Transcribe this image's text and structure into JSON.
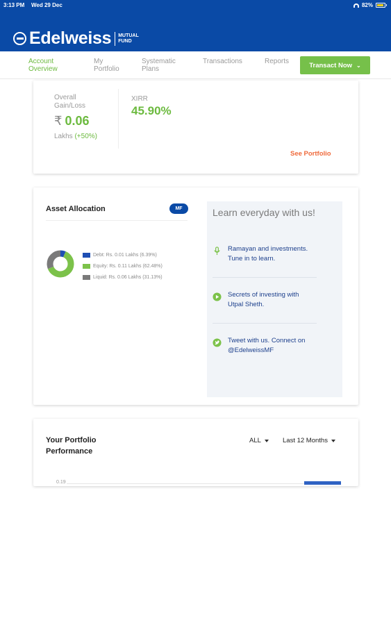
{
  "status_bar": {
    "time": "3:13 PM",
    "date": "Wed 29 Dec",
    "battery": "82%"
  },
  "brand": {
    "name": "Edelweiss",
    "sub_line1": "MUTUAL",
    "sub_line2": "FUND"
  },
  "nav": {
    "items": [
      {
        "line1": "Account",
        "line2": "Overview",
        "active": true
      },
      {
        "line1": "My",
        "line2": "Portfolio",
        "active": false
      },
      {
        "line1": "Systematic",
        "line2": "Plans",
        "active": false
      },
      {
        "line1": "Transactions",
        "line2": "",
        "active": false
      },
      {
        "line1": "Reports",
        "line2": "",
        "active": false
      }
    ],
    "transact_button": "Transact Now"
  },
  "summary": {
    "gain_label_line1": "Overall",
    "gain_label_line2": "Gain/Loss",
    "currency_symbol": "₹",
    "gain_value": "0.06",
    "gain_unit": "Lakhs",
    "gain_percent": "(+50%)",
    "xirr_label": "XIRR",
    "xirr_value": "45.90%",
    "see_portfolio": "See Portfolio"
  },
  "asset_allocation": {
    "title": "Asset Allocation",
    "badge": "MF",
    "items": [
      {
        "label": "Debt: Rs. 0.01 Lakhs (6.39%)",
        "percent": 6.39,
        "color": "#1f4fb4"
      },
      {
        "label": "Equity: Rs. 0.11 Lakhs (62.48%)",
        "percent": 62.48,
        "color": "#7cc24a"
      },
      {
        "label": "Liquid: Rs. 0.06 Lakhs (31.13%)",
        "percent": 31.13,
        "color": "#7a7a7a"
      }
    ]
  },
  "learn": {
    "title": "Learn everyday with us!",
    "items": [
      {
        "icon": "microphone-icon",
        "line1": "Ramayan and investments.",
        "line2": "Tune in to learn."
      },
      {
        "icon": "play-icon",
        "line1": "Secrets of investing with",
        "line2": "Utpal Sheth."
      },
      {
        "icon": "twitter-icon",
        "line1": "Tweet with us. Connect on",
        "line2": "@EdelweissMF"
      }
    ]
  },
  "performance": {
    "title_line1": "Your Portfolio",
    "title_line2": "Performance",
    "filter_scheme": "ALL",
    "filter_period": "Last 12 Months",
    "axis_tick": "0.19"
  },
  "colors": {
    "brand_blue": "#0a4aa6",
    "accent_green": "#76c04a",
    "link_orange": "#ef6a3b"
  }
}
